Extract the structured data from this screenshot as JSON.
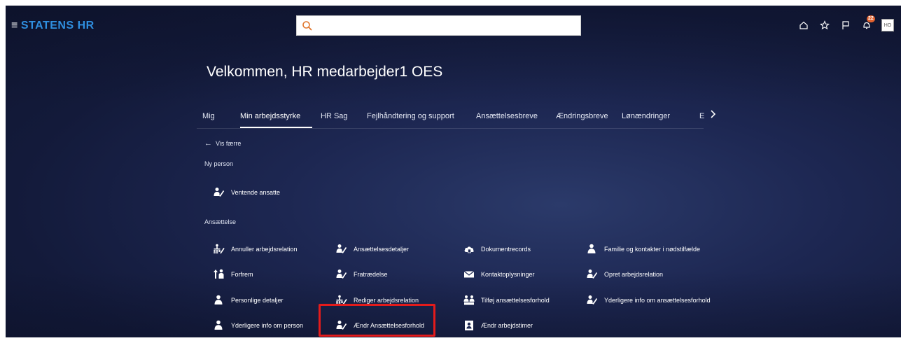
{
  "header": {
    "menu_glyph": "≡",
    "brand": "STATENS HR",
    "search_placeholder": "",
    "notification_count": "22",
    "avatar_initials": "HO",
    "icons": [
      "home-icon",
      "star-icon",
      "flag-icon",
      "bell-icon"
    ]
  },
  "welcome_title": "Velkommen, HR medarbejder1 OES",
  "tabs": [
    {
      "label": "Mig"
    },
    {
      "label": "Min arbejdsstyrke"
    },
    {
      "label": "HR Sag"
    },
    {
      "label": "Fejlhåndtering og support"
    },
    {
      "label": "Ansættelsesbreve"
    },
    {
      "label": "Ændringsbreve"
    },
    {
      "label": "Lønændringer"
    },
    {
      "label": "E"
    }
  ],
  "active_tab": "Min arbejdsstyrke",
  "back_link": "Vis færre",
  "sections": {
    "ny_person": {
      "title": "Ny person",
      "items": [
        {
          "label": "Ventende ansatte",
          "icon": "person-edit-icon"
        }
      ]
    },
    "ansaettelse": {
      "title": "Ansættelse",
      "items": [
        {
          "label": "Annuller arbejdsrelation",
          "icon": "org-edit-icon"
        },
        {
          "label": "Ansættelsesdetaljer",
          "icon": "person-edit-icon"
        },
        {
          "label": "Dokumentrecords",
          "icon": "document-cloud-icon"
        },
        {
          "label": "Familie og kontakter i nødstilfælde",
          "icon": "person-icon"
        },
        {
          "label": "Forfrem",
          "icon": "promote-icon"
        },
        {
          "label": "Fratrædelse",
          "icon": "person-edit-icon"
        },
        {
          "label": "Kontaktoplysninger",
          "icon": "envelope-icon"
        },
        {
          "label": "Opret arbejdsrelation",
          "icon": "person-edit-icon"
        },
        {
          "label": "Personlige detaljer",
          "icon": "person-icon"
        },
        {
          "label": "Rediger arbejdsrelation",
          "icon": "org-edit-icon"
        },
        {
          "label": "Tilføj ansættelsesforhold",
          "icon": "people-add-icon"
        },
        {
          "label": "Yderligere info om ansættelsesforhold",
          "icon": "person-edit-icon"
        },
        {
          "label": "Yderligere info om person",
          "icon": "person-icon"
        },
        {
          "label": "Ændr Ansættelsesforhold",
          "icon": "person-edit-icon"
        },
        {
          "label": "Ændr arbejdstimer",
          "icon": "timesheet-icon"
        }
      ]
    }
  },
  "colors": {
    "brand": "#2f8fe0",
    "highlight": "#e31b1b",
    "badge": "#e2622f"
  }
}
